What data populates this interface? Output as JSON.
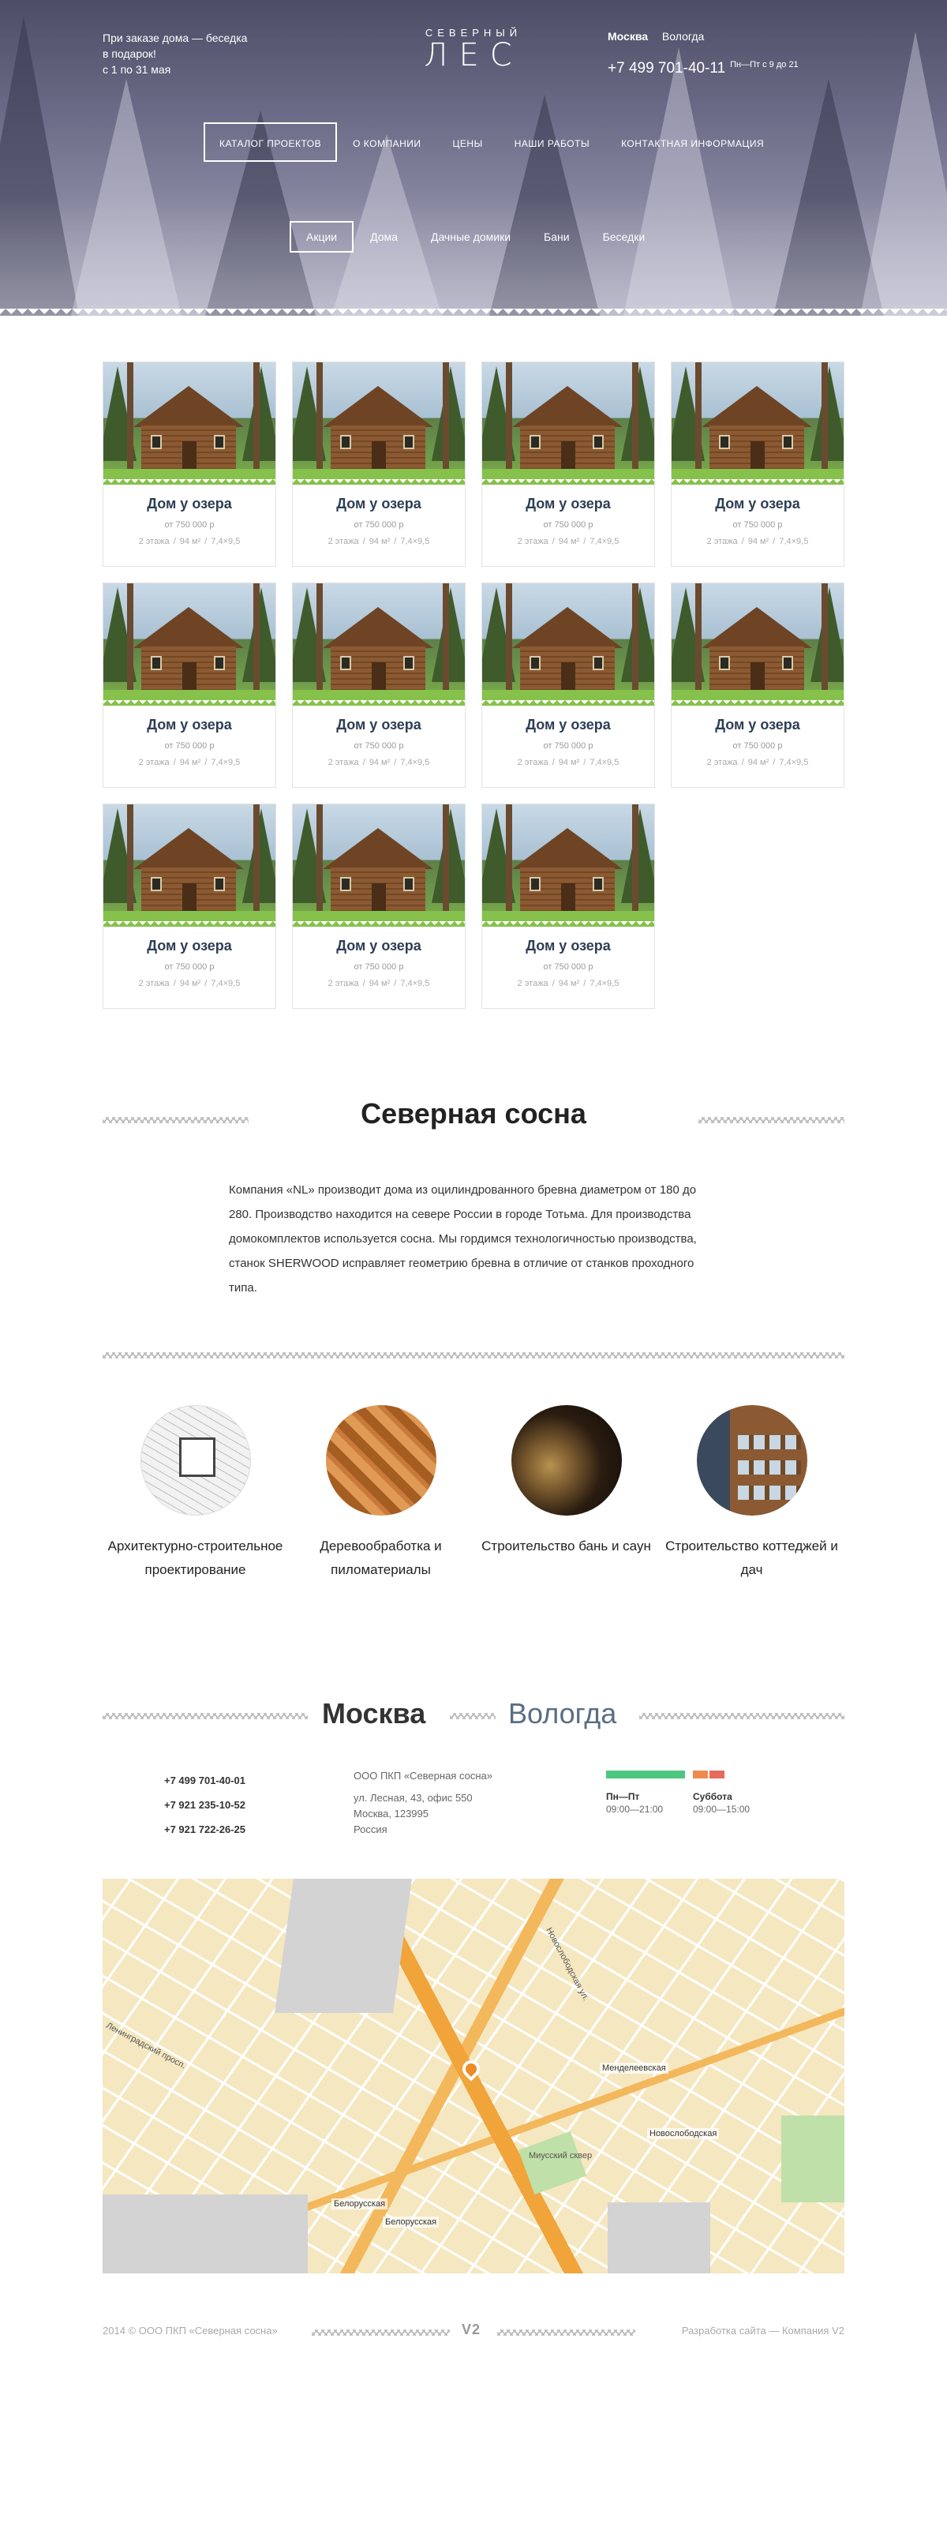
{
  "header": {
    "promo": [
      "При заказе дома — беседка",
      "в подарок!",
      "с 1 по 31 мая"
    ],
    "logo_small": "СЕВЕРНЫЙ",
    "logo_big": "ЛЕС",
    "cities": [
      "Москва",
      "Вологда"
    ],
    "active_city": "Москва",
    "phone": "+7 499 701-40-11",
    "hours": "Пн—Пт с 9 до 21"
  },
  "nav": {
    "items": [
      "КАТАЛОГ ПРОЕКТОВ",
      "О КОМПАНИИ",
      "ЦЕНЫ",
      "НАШИ РАБОТЫ",
      "КОНТАКТНАЯ ИНФОРМАЦИЯ"
    ],
    "active": "КАТАЛОГ ПРОЕКТОВ"
  },
  "categories": {
    "items": [
      "Акции",
      "Дома",
      "Дачные домики",
      "Бани",
      "Беседки"
    ],
    "active": "Акции"
  },
  "products": [
    {
      "title": "Дом у озера",
      "price": "от 750 000 р",
      "floors": "2 этажа",
      "area": "94 м²",
      "size": "7,4×9,5"
    },
    {
      "title": "Дом у озера",
      "price": "от 750 000 р",
      "floors": "2 этажа",
      "area": "94 м²",
      "size": "7,4×9,5"
    },
    {
      "title": "Дом у озера",
      "price": "от 750 000 р",
      "floors": "2 этажа",
      "area": "94 м²",
      "size": "7,4×9,5"
    },
    {
      "title": "Дом у озера",
      "price": "от 750 000 р",
      "floors": "2 этажа",
      "area": "94 м²",
      "size": "7,4×9,5"
    },
    {
      "title": "Дом у озера",
      "price": "от 750 000 р",
      "floors": "2 этажа",
      "area": "94 м²",
      "size": "7,4×9,5"
    },
    {
      "title": "Дом у озера",
      "price": "от 750 000 р",
      "floors": "2 этажа",
      "area": "94 м²",
      "size": "7,4×9,5"
    },
    {
      "title": "Дом у озера",
      "price": "от 750 000 р",
      "floors": "2 этажа",
      "area": "94 м²",
      "size": "7,4×9,5"
    },
    {
      "title": "Дом у озера",
      "price": "от 750 000 р",
      "floors": "2 этажа",
      "area": "94 м²",
      "size": "7,4×9,5"
    },
    {
      "title": "Дом у озера",
      "price": "от 750 000 р",
      "floors": "2 этажа",
      "area": "94 м²",
      "size": "7,4×9,5"
    },
    {
      "title": "Дом у озера",
      "price": "от 750 000 р",
      "floors": "2 этажа",
      "area": "94 м²",
      "size": "7,4×9,5"
    },
    {
      "title": "Дом у озера",
      "price": "от 750 000 р",
      "floors": "2 этажа",
      "area": "94 м²",
      "size": "7,4×9,5"
    }
  ],
  "about": {
    "title": "Северная сосна",
    "text": "Компания «NL» производит дома из оцилиндрованного бревна диаметром от 180 до 280. Производство находится на севере России в городе Тотьма. Для производства домокомплектов используется сосна. Мы гордимся технологичностью производства, станок SHERWOOD исправляет геометрию бревна в отличие от станков проходного типа."
  },
  "features": [
    {
      "caption": "Архитектурно-строительное проектирование"
    },
    {
      "caption": "Деревообработка и пиломатериалы"
    },
    {
      "caption": "Строительство бань и саун"
    },
    {
      "caption": "Строительство коттеджей и дач"
    }
  ],
  "contacts": {
    "cities": [
      "Москва",
      "Вологда"
    ],
    "active_city": "Москва",
    "phones": [
      "+7 499 701-40-01",
      "+7 921 235-10-52",
      "+7 921 722-26-25"
    ],
    "org": "ООО ПКП «Северная сосна»",
    "address": [
      "ул. Лесная, 43, офис 550",
      "Москва, 123995",
      "Россия"
    ],
    "schedule": [
      {
        "days": "Пн—Пт",
        "time": "09:00—21:00",
        "color": "#4cc77f"
      },
      {
        "days": "Суббота",
        "time": "09:00—15:00",
        "color": "#f08a4b"
      }
    ]
  },
  "map": {
    "stations": [
      "Белорусская",
      "Белорусская",
      "Менделеевская",
      "Новослободская"
    ],
    "labels": [
      "Ленинградский просп.",
      "Новослободская ул.",
      "Миусский сквер"
    ]
  },
  "footer": {
    "copyright": "2014 © ООО ПКП «Северная сосна»",
    "logo": "V2",
    "developer": "Разработка сайта — Компания V2"
  }
}
